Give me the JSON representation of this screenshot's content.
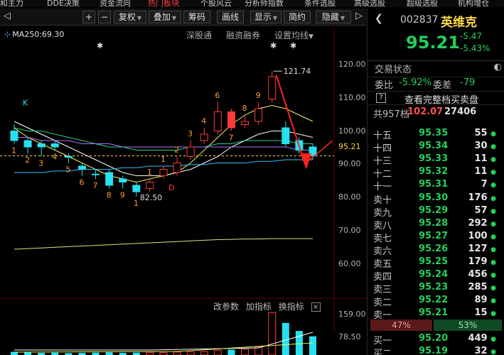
{
  "topnav": {
    "items": [
      {
        "label": "和主力",
        "active": false
      },
      {
        "label": "DDE决策",
        "active": false
      },
      {
        "label": "资金流向",
        "active": false
      },
      {
        "label": "热门板块",
        "active": true
      },
      {
        "label": "个股风云",
        "active": false
      },
      {
        "label": "分析师指数",
        "active": false
      },
      {
        "label": "条件选股",
        "active": false
      },
      {
        "label": "高级选股",
        "active": false
      },
      {
        "label": "超级选股",
        "active": false
      },
      {
        "label": "机构增仓",
        "active": false
      }
    ]
  },
  "toolbar": {
    "nav_left": "◁",
    "plus": "+",
    "minus": "−",
    "fuquan": "复权",
    "diejia": "叠加",
    "chouma": "筹码",
    "huaxian": "画线",
    "xianshi": "显示",
    "jianyue": "简约",
    "yincang": "隐藏",
    "nav_right": "▷"
  },
  "chart": {
    "ma_label": "MA250:69.30",
    "links": {
      "shen": "深股通",
      "rongzi": "融资融券",
      "settings": "设置均线"
    },
    "y_labels": [
      "120.00",
      "110.00",
      "100.00",
      "90.00",
      "80.00",
      "70.00",
      "60.00"
    ],
    "current_price": "95.21",
    "high_label": "121.74",
    "low_label": "82.50",
    "vol_labels": [
      "159.00",
      "78.50"
    ],
    "indicator_bar": {
      "a": "改参数",
      "b": "加指标",
      "c": "换指标",
      "close": "×"
    },
    "markers": {
      "k": "K",
      "d": "D",
      "star": "✱"
    }
  },
  "chart_data": {
    "type": "candlestick",
    "ylim": [
      60,
      125
    ],
    "candles": [
      {
        "o": 103,
        "c": 100,
        "h": 105,
        "l": 99,
        "up": false,
        "label": "1"
      },
      {
        "o": 100,
        "c": 98,
        "h": 101,
        "l": 96,
        "up": false,
        "label": "2"
      },
      {
        "o": 99,
        "c": 98,
        "h": 100,
        "l": 95,
        "up": false,
        "label": "3"
      },
      {
        "o": 99,
        "c": 98,
        "h": 100,
        "l": 97,
        "up": false,
        "label": "4"
      },
      {
        "o": 95,
        "c": 95,
        "h": 96,
        "l": 93,
        "up": false,
        "label": "5"
      },
      {
        "o": 92,
        "c": 91,
        "h": 93,
        "l": 89,
        "up": false,
        "label": "6"
      },
      {
        "o": 89.5,
        "c": 89.5,
        "h": 91,
        "l": 88,
        "up": false,
        "label": "7"
      },
      {
        "o": 90,
        "c": 86,
        "h": 91,
        "l": 85,
        "up": false,
        "label": "8"
      },
      {
        "o": 88,
        "c": 87,
        "h": 89,
        "l": 85,
        "up": false,
        "label": "9"
      },
      {
        "o": 86,
        "c": 84,
        "h": 87,
        "l": 82.5,
        "up": false,
        "label": "1"
      },
      {
        "o": 85,
        "c": 87,
        "h": 88,
        "l": 84,
        "up": true,
        "label": "1"
      },
      {
        "o": 89,
        "c": 91,
        "h": 92,
        "l": 88,
        "up": true,
        "label": "1"
      },
      {
        "o": 90,
        "c": 93,
        "h": 95,
        "l": 89,
        "up": true,
        "label": "2"
      },
      {
        "o": 95,
        "c": 98,
        "h": 100,
        "l": 94,
        "up": true,
        "label": "3"
      },
      {
        "o": 100,
        "c": 102,
        "h": 104,
        "l": 99,
        "up": true,
        "label": "4"
      },
      {
        "o": 103,
        "c": 109,
        "h": 112,
        "l": 102,
        "up": true,
        "label": "6"
      },
      {
        "o": 109,
        "c": 104,
        "h": 110,
        "l": 103,
        "up": false,
        "label": "7",
        "red": true
      },
      {
        "o": 105,
        "c": 106,
        "h": 108,
        "l": 104,
        "up": true,
        "label": "8"
      },
      {
        "o": 106,
        "c": 110,
        "h": 112,
        "l": 105,
        "up": true,
        "label": "9"
      },
      {
        "o": 113,
        "c": 120,
        "h": 121.74,
        "l": 112,
        "up": true,
        "label": ""
      },
      {
        "o": 104,
        "c": 99,
        "h": 106,
        "l": 98,
        "up": false,
        "label": ""
      },
      {
        "o": 100,
        "c": 97,
        "h": 101,
        "l": 96,
        "up": false,
        "label": ""
      },
      {
        "o": 98,
        "c": 95.21,
        "h": 99,
        "l": 94,
        "up": false,
        "label": ""
      }
    ],
    "volume": [
      12,
      10,
      8,
      9,
      7,
      8,
      9,
      10,
      8,
      9,
      10,
      9,
      11,
      12,
      13,
      18,
      20,
      22,
      30,
      159,
      120,
      90,
      70
    ]
  },
  "panel": {
    "code": "002837",
    "name": "英维克",
    "price": "95.21",
    "change": "-5.47",
    "change_pct": "-5.43%",
    "status_label": "交易状态",
    "status_icon": "◐",
    "ratio": {
      "a": "委比",
      "b": "-5.92%",
      "c": "委差",
      "d": "-79"
    },
    "full_book": "查看完整档买卖盘",
    "total": {
      "a": "共957档",
      "b": "102.07",
      "c": "27406"
    },
    "asks": [
      {
        "label": "十五",
        "price": "95.35",
        "vol": "55",
        "mark": "●"
      },
      {
        "label": "十四",
        "price": "95.34",
        "vol": "30",
        "mark": "●"
      },
      {
        "label": "十三",
        "price": "95.33",
        "vol": "11",
        "mark": "●"
      },
      {
        "label": "十二",
        "price": "95.32",
        "vol": "11",
        "mark": "●"
      },
      {
        "label": "十一",
        "price": "95.31",
        "vol": "7",
        "mark": "●"
      },
      {
        "label": "卖十",
        "price": "95.30",
        "vol": "176",
        "mark": "●"
      },
      {
        "label": "卖九",
        "price": "95.29",
        "vol": "57",
        "mark": "●"
      },
      {
        "label": "卖八",
        "price": "95.28",
        "vol": "292",
        "mark": "●"
      },
      {
        "label": "卖七",
        "price": "95.27",
        "vol": "100",
        "mark": "●"
      },
      {
        "label": "卖六",
        "price": "95.26",
        "vol": "127",
        "mark": "●"
      },
      {
        "label": "卖五",
        "price": "95.25",
        "vol": "179",
        "mark": "●"
      },
      {
        "label": "卖四",
        "price": "95.24",
        "vol": "456",
        "mark": "●"
      },
      {
        "label": "卖三",
        "price": "95.23",
        "vol": "285",
        "mark": "●"
      },
      {
        "label": "卖二",
        "price": "95.22",
        "vol": "89",
        "mark": "●"
      },
      {
        "label": "卖一",
        "price": "95.21",
        "vol": "15",
        "mark": "●"
      }
    ],
    "sell_pct": "47%",
    "buy_pct": "53%",
    "sell_fraction": 0.47,
    "bids": [
      {
        "label": "买一",
        "price": "95.20",
        "vol": "449",
        "mark": "●"
      },
      {
        "label": "买二",
        "price": "95.19",
        "vol": "32",
        "mark": "●"
      }
    ]
  },
  "colors": {
    "up": "#ff3b3b",
    "down": "#27e0f0",
    "green": "#22d05a",
    "yellow": "#ffd84a"
  }
}
